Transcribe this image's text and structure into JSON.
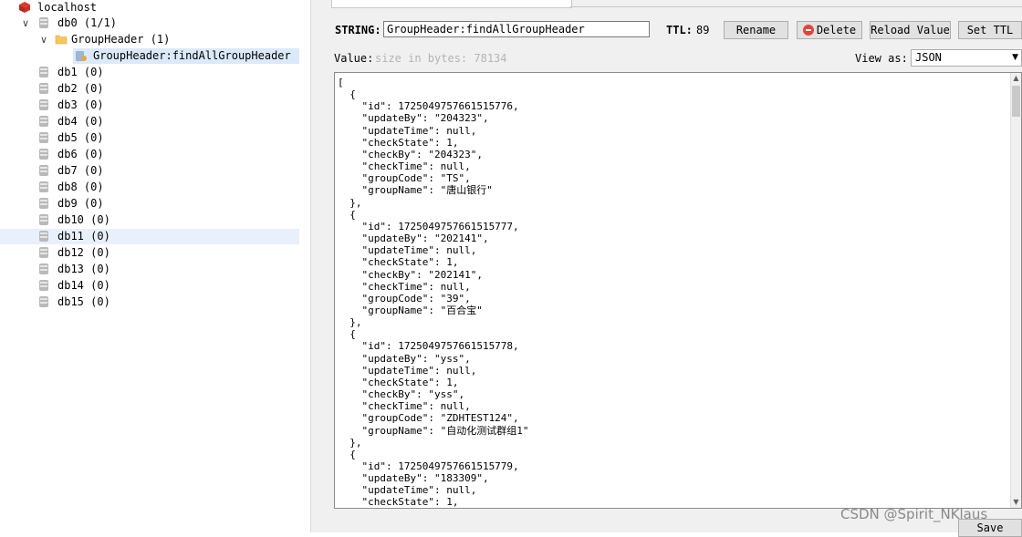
{
  "tree": {
    "server": "localhost",
    "db0": "db0  (1/1)",
    "folder": "GroupHeader  (1)",
    "key": "GroupHeader:findAllGroupHeader",
    "databases": [
      "db1  (0)",
      "db2  (0)",
      "db3  (0)",
      "db4  (0)",
      "db5  (0)",
      "db6  (0)",
      "db7  (0)",
      "db8  (0)",
      "db9  (0)",
      "db10  (0)",
      "db11  (0)",
      "db12  (0)",
      "db13  (0)",
      "db14  (0)",
      "db15  (0)"
    ]
  },
  "toolbar": {
    "type_label": "STRING:",
    "key_value": "GroupHeader:findAllGroupHeader",
    "ttl_label": "TTL:",
    "ttl_value": "89",
    "rename": "Rename",
    "delete": "Delete",
    "reload": "Reload Value",
    "set_ttl": "Set TTL"
  },
  "value_bar": {
    "label": "Value:",
    "size": "size in bytes: 78134",
    "view_as_label": "View as:",
    "view_as_value": "JSON"
  },
  "editor": {
    "content": "[\n  {\n    \"id\": 1725049757661515776,\n    \"updateBy\": \"204323\",\n    \"updateTime\": null,\n    \"checkState\": 1,\n    \"checkBy\": \"204323\",\n    \"checkTime\": null,\n    \"groupCode\": \"TS\",\n    \"groupName\": \"唐山银行\"\n  },\n  {\n    \"id\": 1725049757661515777,\n    \"updateBy\": \"202141\",\n    \"updateTime\": null,\n    \"checkState\": 1,\n    \"checkBy\": \"202141\",\n    \"checkTime\": null,\n    \"groupCode\": \"39\",\n    \"groupName\": \"百合宝\"\n  },\n  {\n    \"id\": 1725049757661515778,\n    \"updateBy\": \"yss\",\n    \"updateTime\": null,\n    \"checkState\": 1,\n    \"checkBy\": \"yss\",\n    \"checkTime\": null,\n    \"groupCode\": \"ZDHTEST124\",\n    \"groupName\": \"自动化测试群组1\"\n  },\n  {\n    \"id\": 1725049757661515779,\n    \"updateBy\": \"183309\",\n    \"updateTime\": null,\n    \"checkState\": 1,"
  },
  "save": "Save",
  "watermark": "CSDN @Spirit_NKlaus"
}
